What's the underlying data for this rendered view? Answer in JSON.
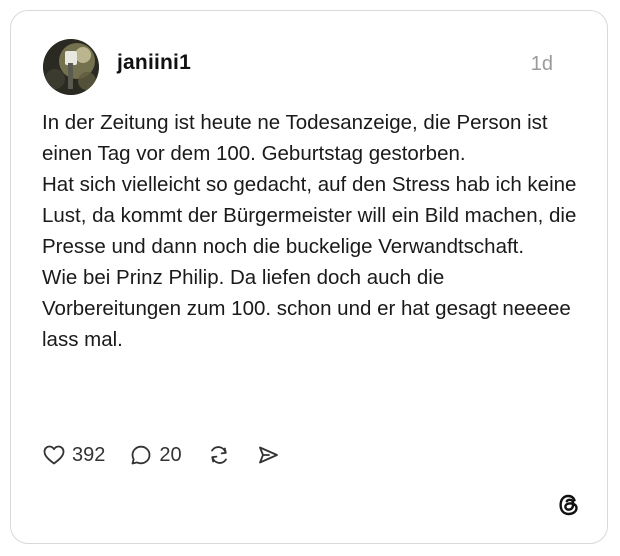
{
  "post": {
    "username": "janiini1",
    "time": "1d",
    "paragraphs": [
      "In der Zeitung ist heute ne Todesanzeige, die Person ist einen Tag vor dem 100. Geburtstag gestorben.",
      "Hat sich vielleicht so gedacht, auf den Stress hab ich keine Lust, da kommt der Bürgermeister will ein Bild machen, die Presse und dann noch die buckelige Verwandtschaft.",
      "Wie bei Prinz Philip. Da liefen doch auch die Vorbereitungen zum 100. schon und er hat gesagt neeeee lass mal."
    ]
  },
  "actions": {
    "likes": "392",
    "replies": "20",
    "like_icon": "heart-icon",
    "reply_icon": "comment-bubble-icon",
    "repost_icon": "repost-icon",
    "share_icon": "send-icon"
  },
  "brand": {
    "logo_icon": "threads-logo-icon"
  }
}
